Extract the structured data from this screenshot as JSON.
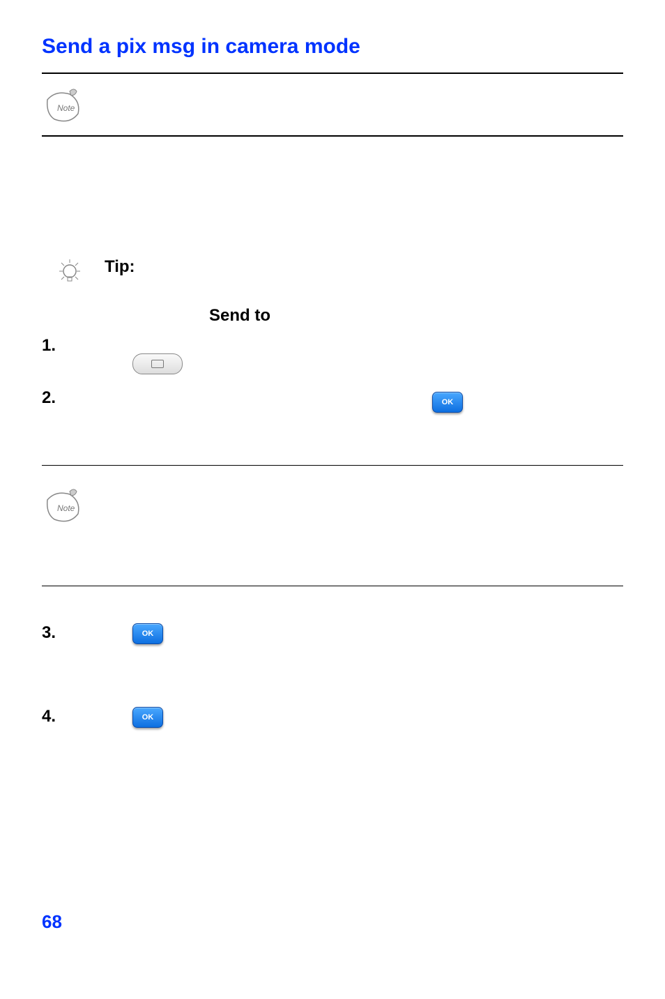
{
  "title": "Send a pix msg in camera mode",
  "tip_label": "Tip:",
  "send_to": "Send to",
  "steps": {
    "one": "1.",
    "two": "2.",
    "three": "3.",
    "four": "4."
  },
  "ok_label": "OK",
  "page_number": "68"
}
